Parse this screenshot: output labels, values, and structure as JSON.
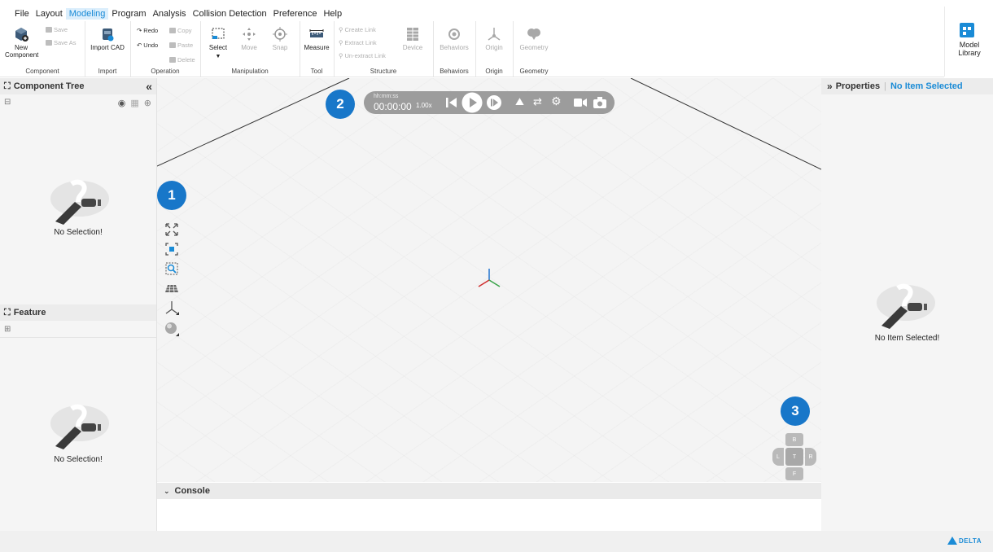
{
  "menu": [
    "File",
    "Layout",
    "Modeling",
    "Program",
    "Analysis",
    "Collision Detection",
    "Preference",
    "Help"
  ],
  "menu_active": "Modeling",
  "ribbon": {
    "component": {
      "label": "Component",
      "new_component": "New Component",
      "save": "Save",
      "save_as": "Save As"
    },
    "import": {
      "label": "Import",
      "import_cad": "Import CAD"
    },
    "operation": {
      "label": "Operation",
      "redo": "Redo",
      "undo": "Undo",
      "copy": "Copy",
      "paste": "Paste",
      "delete": "Delete"
    },
    "manipulation": {
      "label": "Manipulation",
      "select": "Select",
      "move": "Move",
      "snap": "Snap"
    },
    "tool": {
      "label": "Tool",
      "measure": "Measure"
    },
    "structure": {
      "label": "Structure",
      "create_link": "Create Link",
      "extract_link": "Extract Link",
      "unextract_link": "Un-extract Link",
      "device": "Device"
    },
    "behaviors": {
      "label": "Behaviors",
      "behaviors": "Behaviors"
    },
    "origin": {
      "label": "Origin",
      "origin": "Origin"
    },
    "geometry": {
      "label": "Geometry",
      "geometry": "Geometry"
    }
  },
  "model_library": {
    "line1": "Model",
    "line2": "Library"
  },
  "component_tree": {
    "title": "Component Tree",
    "empty": "No Selection!"
  },
  "feature": {
    "title": "Feature",
    "empty": "No Selection!"
  },
  "properties": {
    "title": "Properties",
    "status": "No Item Selected",
    "empty": "No Item Selected!"
  },
  "timebar": {
    "format": "hh:mm:ss",
    "time": "00:00:00",
    "speed": "1.00x"
  },
  "badges": [
    "1",
    "2",
    "3"
  ],
  "nav_cube": {
    "back": "B",
    "left": "L",
    "top": "T",
    "right": "R",
    "front": "F"
  },
  "console": {
    "title": "Console"
  },
  "brand": "DELTA",
  "colors": {
    "accent": "#1a8bd6",
    "badge": "#1877c9",
    "timebar": "#9c9c9c"
  }
}
